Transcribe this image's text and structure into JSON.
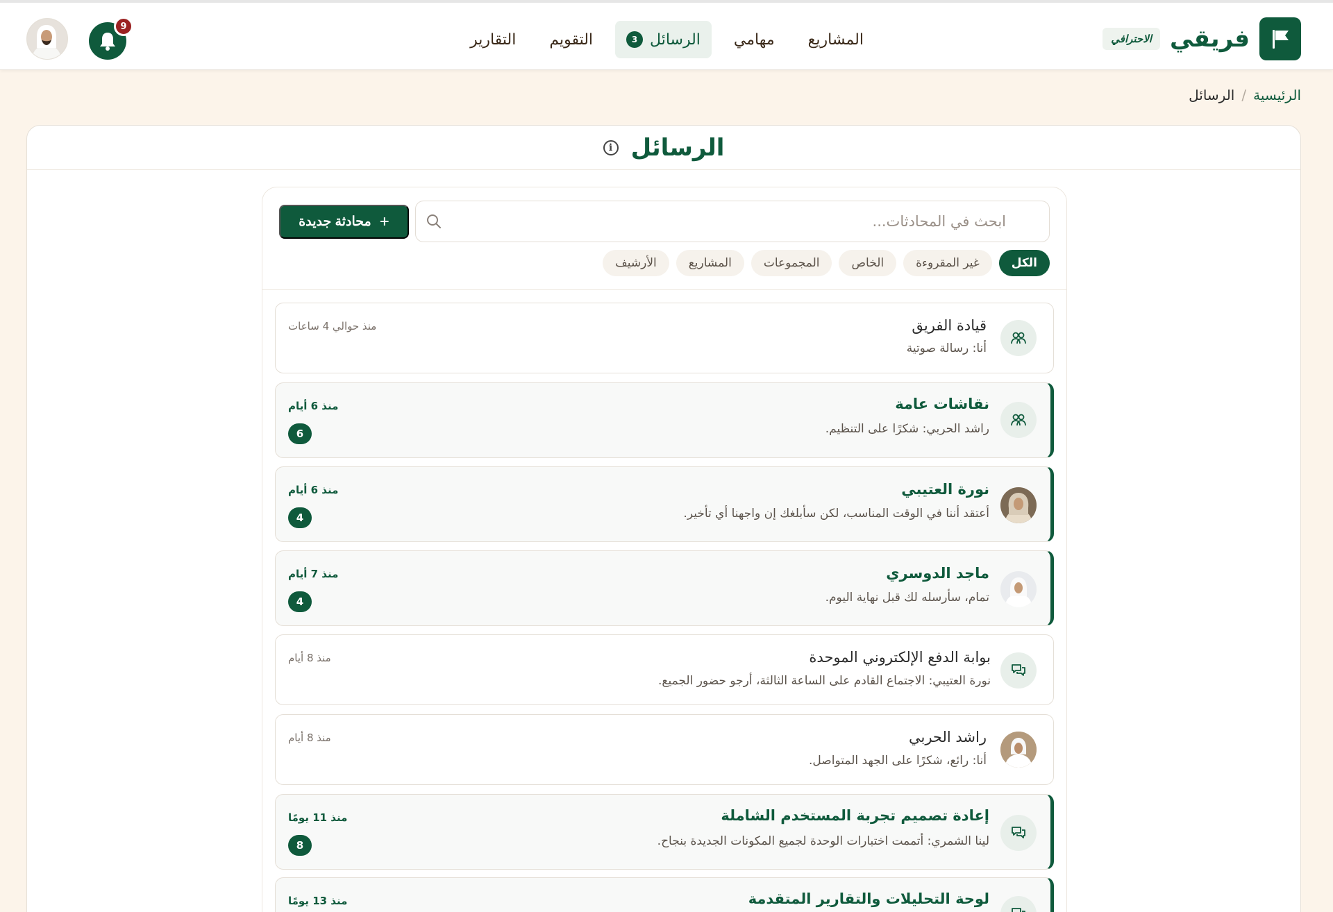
{
  "brand": {
    "name": "فريقي",
    "tag": "الاحترافي"
  },
  "nav": {
    "projects": "المشاريع",
    "tasks": "مهامي",
    "messages": "الرسائل",
    "messages_badge": "3",
    "calendar": "التقويم",
    "reports": "التقارير"
  },
  "notifications": {
    "count": "9"
  },
  "breadcrumb": {
    "home": "الرئيسية",
    "separator": "/",
    "current": "الرسائل"
  },
  "page": {
    "title": "الرسائل",
    "info_glyph": "i"
  },
  "toolbar": {
    "new_chat_label": "محادثة جديدة",
    "new_chat_glyph": "+",
    "search_placeholder": "ابحث في المحادثات..."
  },
  "filters": [
    "الكل",
    "غير المقروءة",
    "الخاص",
    "المجموعات",
    "المشاريع",
    "الأرشيف"
  ],
  "active_filter": "الكل",
  "conversations": [
    {
      "name": "قيادة الفريق",
      "preview": "أنا: رسالة صوتية",
      "time": "منذ حوالي 4 ساعات",
      "unread": false,
      "count": "",
      "icon": "group-icon"
    },
    {
      "name": "نقاشات عامة",
      "preview": "راشد الحربي: شكرًا على التنظيم.",
      "time": "منذ 6 أيام",
      "unread": true,
      "count": "6",
      "icon": "group-icon"
    },
    {
      "name": "نورة العتيبي",
      "preview": "أعتقد أننا في الوقت المناسب، لكن سأبلغك إن واجهنا أي تأخير.",
      "time": "منذ 6 أيام",
      "unread": true,
      "count": "4",
      "icon": "user-photo"
    },
    {
      "name": "ماجد الدوسري",
      "preview": "تمام، سأرسله لك قبل نهاية اليوم.",
      "time": "منذ 7 أيام",
      "unread": true,
      "count": "4",
      "icon": "user-photo"
    },
    {
      "name": "بوابة الدفع الإلكتروني الموحدة",
      "preview": "نورة العتيبي: الاجتماع القادم على الساعة الثالثة، أرجو حضور الجميع.",
      "time": "منذ 8 أيام",
      "unread": false,
      "count": "",
      "icon": "chat-icon"
    },
    {
      "name": "راشد الحربي",
      "preview": "أنا: رائع، شكرًا على الجهد المتواصل.",
      "time": "منذ 8 أيام",
      "unread": false,
      "count": "",
      "icon": "user-photo"
    },
    {
      "name": "إعادة تصميم تجربة المستخدم الشاملة",
      "preview": "لينا الشمري: أتممت اختبارات الوحدة لجميع المكونات الجديدة بنجاح.",
      "time": "منذ 11 يومًا",
      "unread": true,
      "count": "8",
      "icon": "chat-icon"
    },
    {
      "name": "لوحة التحليلات والتقارير المتقدمة",
      "preview": "",
      "time": "منذ 13 يومًا",
      "unread": true,
      "count": "",
      "icon": "chat-icon"
    }
  ],
  "colors": {
    "primary": "#0f5a3c",
    "background": "#fcf4ea",
    "alert": "#9b2222"
  }
}
